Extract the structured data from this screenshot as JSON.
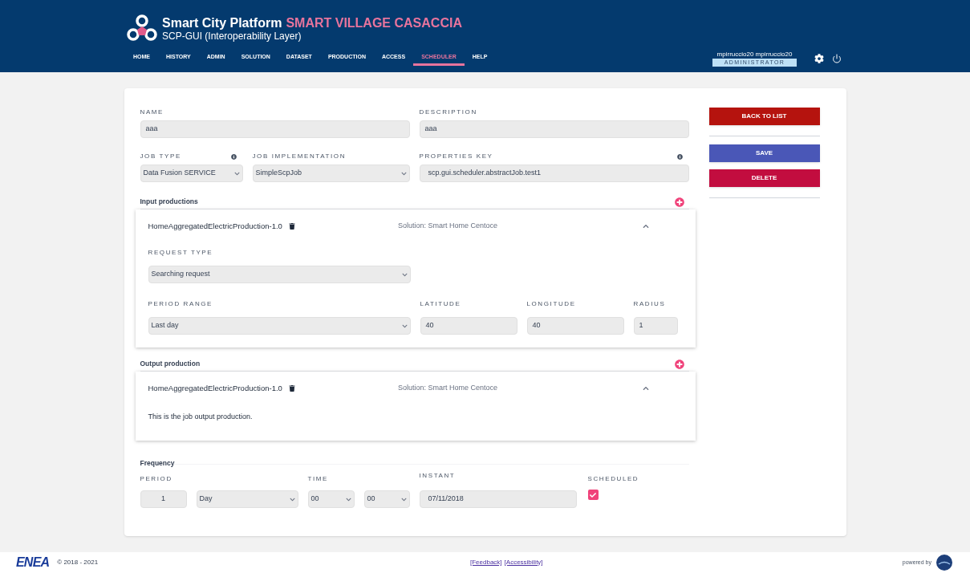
{
  "header": {
    "title": "Smart City Platform",
    "site": "SMART VILLAGE CASACCIA",
    "subtitle": "SCP-GUI (Interoperability Layer)",
    "nav": [
      {
        "label": "HOME",
        "selected": false
      },
      {
        "label": "HISTORY",
        "selected": false
      },
      {
        "label": "ADMIN",
        "selected": false
      },
      {
        "label": "SOLUTION",
        "selected": false
      },
      {
        "label": "DATASET",
        "selected": false
      },
      {
        "label": "PRODUCTION",
        "selected": false
      },
      {
        "label": "ACCESS",
        "selected": false
      },
      {
        "label": "SCHEDULER",
        "selected": true
      },
      {
        "label": "HELP",
        "selected": false
      }
    ],
    "user": {
      "name": "mpirruccio20 mpirruccio20",
      "role": "ADMINISTRATOR"
    }
  },
  "form": {
    "name": {
      "label": "NAME",
      "value": "aaa"
    },
    "description": {
      "label": "DESCRIPTION",
      "value": "aaa"
    },
    "job_type": {
      "label": "JOB TYPE",
      "value": "Data Fusion SERVICE"
    },
    "job_implementation": {
      "label": "JOB IMPLEMENTATION",
      "value": "SimpleScpJob"
    },
    "properties_key": {
      "label": "PROPERTIES KEY",
      "value": "scp.gui.scheduler.abstractJob.test1"
    },
    "input": {
      "heading": "Input productions",
      "name": "HomeAggregatedElectricProduction-1.0",
      "solution": "Solution: Smart Home Centoce",
      "expanded": true,
      "request_type": {
        "label": "REQUEST TYPE",
        "value": "Searching request"
      },
      "period_range": {
        "label": "PERIOD RANGE",
        "value": "Last day"
      },
      "latitude": {
        "label": "LATITUDE",
        "value": "40"
      },
      "longitude": {
        "label": "LONGITUDE",
        "value": "40"
      },
      "radius": {
        "label": "RADIUS",
        "value": "1"
      }
    },
    "output": {
      "heading": "Output production",
      "name": "HomeAggregatedElectricProduction-1.0",
      "solution": "Solution: Smart Home Centoce",
      "expanded": true,
      "text": "This is the job output production."
    },
    "frequency": {
      "heading": "Frequency",
      "period_label": "PERIOD",
      "period": "1",
      "unit": "Day",
      "time_label": "TIME",
      "hour": "00",
      "minute": "00",
      "instant_label": "INSTANT",
      "instant": "07/11/2018",
      "scheduled_label": "SCHEDULED",
      "scheduled": true
    }
  },
  "actions": {
    "back": "BACK TO LIST",
    "save": "SAVE",
    "delete": "DELETE"
  },
  "footer": {
    "logo": "ENEA",
    "copyright": "© 2018 - 2021",
    "links": [
      "[Feedback]",
      "[Accessibility]"
    ],
    "powered": "powered by"
  }
}
